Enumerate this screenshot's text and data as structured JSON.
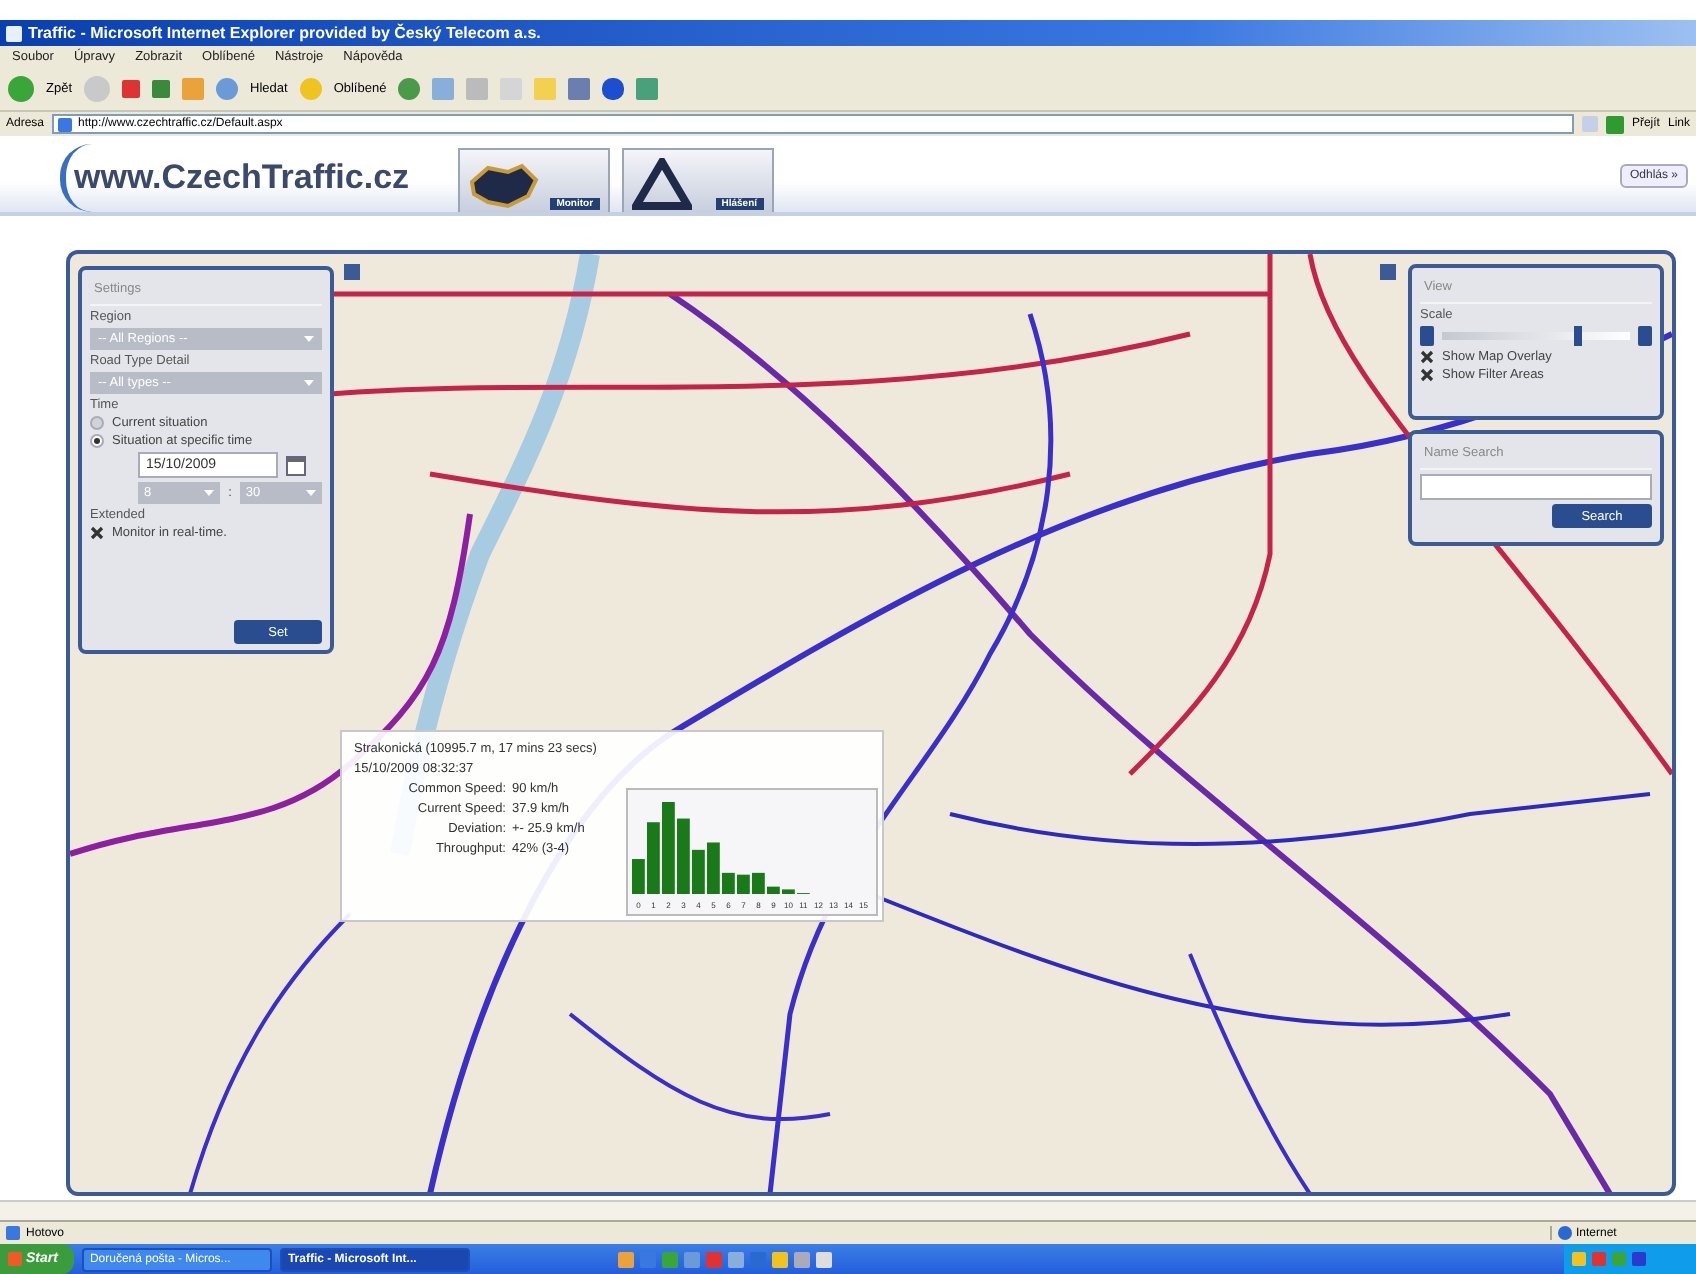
{
  "window": {
    "title": "Traffic - Microsoft Internet Explorer provided by Český Telecom a.s."
  },
  "menu": [
    "Soubor",
    "Úpravy",
    "Zobrazit",
    "Oblíbené",
    "Nástroje",
    "Nápověda"
  ],
  "toolbar": {
    "back": "Zpět",
    "search": "Hledat",
    "favorites": "Oblíbené"
  },
  "address": {
    "label": "Adresa",
    "url": "http://www.czechtraffic.cz/Default.aspx",
    "go": "Přejít",
    "links": "Link"
  },
  "header": {
    "logo": "www.CzechTraffic.cz",
    "nav": [
      {
        "kind": "monitor",
        "label": "Monitor"
      },
      {
        "kind": "report",
        "label": "Hlášení"
      }
    ],
    "logout": "Odhlás »"
  },
  "settings": {
    "title": "Settings",
    "region_label": "Region",
    "region": "-- All Regions --",
    "road_label": "Road Type Detail",
    "road": "-- All types --",
    "time_label": "Time",
    "time_options": [
      {
        "label": "Current situation",
        "selected": false
      },
      {
        "label": "Situation at specific time",
        "selected": true
      }
    ],
    "date": "15/10/2009",
    "hour": "8",
    "separator": ":",
    "minute": "30",
    "extended_label": "Extended",
    "monitor": {
      "label": "Monitor in real-time.",
      "checked": true
    },
    "set_button": "Set"
  },
  "view": {
    "title": "View",
    "scale_label": "Scale",
    "scale": {
      "level": 0.72
    },
    "options": [
      {
        "label": "Show Map Overlay",
        "checked": true
      },
      {
        "label": "Show Filter Areas",
        "checked": true
      }
    ]
  },
  "name_search": {
    "title": "Name Search",
    "button": "Search"
  },
  "popup": {
    "title": "Strakonická (10995.7 m, 17 mins 23 secs)",
    "time": "15/10/2009 08:32:37",
    "rows": [
      {
        "label": "Common Speed:",
        "value": "90 km/h"
      },
      {
        "label": "Current Speed:",
        "value": "37.9 km/h"
      },
      {
        "label": "Deviation:",
        "value": "+- 25.9 km/h"
      },
      {
        "label": "Throughput:",
        "value": "42% (3-4)"
      }
    ],
    "histogram_labels": [
      "0",
      "1",
      "2",
      "3",
      "4",
      "5",
      "6",
      "7",
      "8",
      "9",
      "10",
      "11",
      "12",
      "13",
      "14",
      "15"
    ]
  },
  "status_bar": {
    "text": "Hotovo",
    "zone": "Internet"
  },
  "taskbar": {
    "start": "Start",
    "tasks": [
      {
        "label": "Doručená pošta - Micros...",
        "selected": false
      },
      {
        "label": "Traffic - Microsoft Int...",
        "selected": true
      }
    ]
  }
}
